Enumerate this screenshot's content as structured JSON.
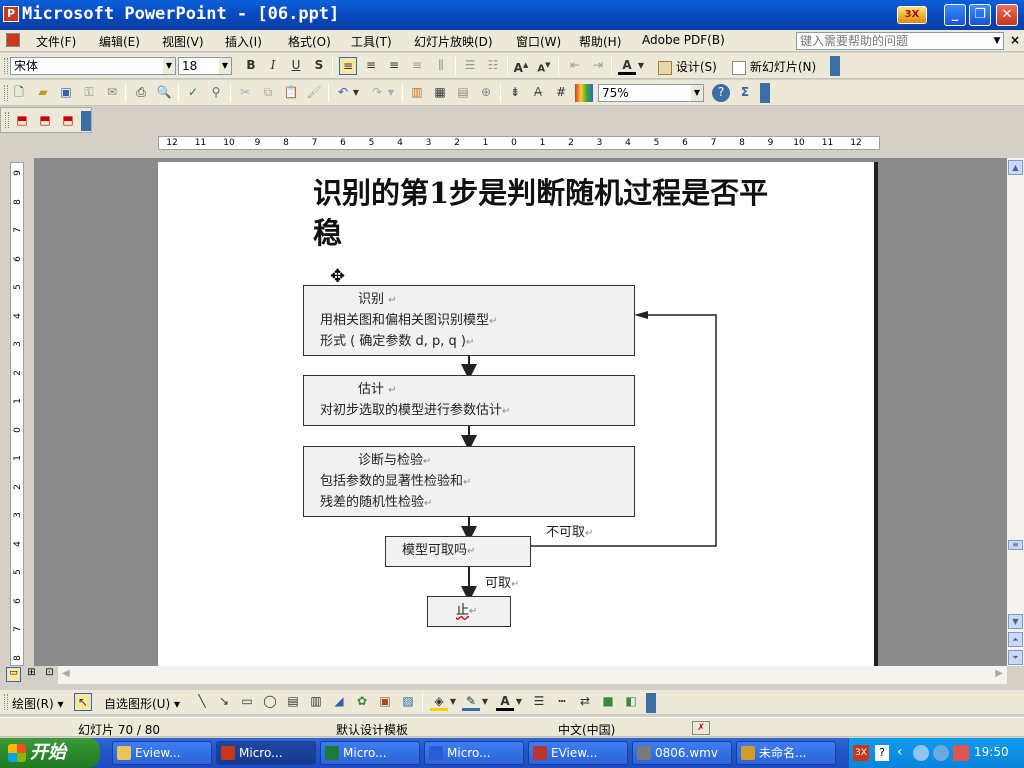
{
  "window": {
    "title": "Microsoft PowerPoint - [06.ppt]",
    "badge": "3X"
  },
  "menu": [
    "文件(F)",
    "编辑(E)",
    "视图(V)",
    "插入(I)",
    "格式(O)",
    "工具(T)",
    "幻灯片放映(D)",
    "窗口(W)",
    "帮助(H)",
    "Adobe PDF(B)"
  ],
  "help_box": {
    "placeholder": "键入需要帮助的问题"
  },
  "formatting": {
    "font": "宋体",
    "size": "18",
    "design_label": "设计(S)",
    "new_slide_label": "新幻灯片(N)"
  },
  "standard": {
    "zoom": "75%"
  },
  "ruler": {
    "top": [
      "12",
      "11",
      "10",
      "9",
      "8",
      "7",
      "6",
      "5",
      "4",
      "3",
      "2",
      "1",
      "0",
      "1",
      "2",
      "3",
      "4",
      "5",
      "6",
      "7",
      "8",
      "9",
      "10",
      "11",
      "12"
    ],
    "left": [
      "9",
      "8",
      "7",
      "6",
      "5",
      "4",
      "3",
      "2",
      "1",
      "0",
      "1",
      "2",
      "3",
      "4",
      "5",
      "6",
      "7",
      "8"
    ]
  },
  "slide": {
    "title": "识别的第1步是判断随机过程是否平稳",
    "boxes": [
      {
        "heading": "识别",
        "lines": [
          "用相关图和偏相关图识别模型",
          "形式 ( 确定参数 d, p, q )"
        ]
      },
      {
        "heading": "估计",
        "lines": [
          "对初步选取的模型进行参数估计"
        ]
      },
      {
        "heading": "诊断与检验",
        "lines": [
          "包括参数的显著性检验和",
          "残差的随机性检验"
        ]
      }
    ],
    "decision": "模型可取吗",
    "reject_label": "不可取",
    "accept_label": "可取",
    "end": "止",
    "return_mark": "↵"
  },
  "drawbar": {
    "draw_label": "绘图(R)",
    "autoshape_label": "自选图形(U)"
  },
  "status": {
    "slide": "幻灯片 70 / 80",
    "template": "默认设计模板",
    "language": "中文(中国)"
  },
  "taskbar": {
    "start": "开始",
    "tasks": [
      {
        "label": "Eview...",
        "color": "#e8c45a"
      },
      {
        "label": "Micro...",
        "color": "#c8391c"
      },
      {
        "label": "Micro...",
        "color": "#1d7a3a"
      },
      {
        "label": "Micro...",
        "color": "#2a5bd7"
      },
      {
        "label": "EView...",
        "color": "#b33"
      },
      {
        "label": "0806.wmv",
        "color": "#7a7a7a"
      },
      {
        "label": "未命名...",
        "color": "#d49a2a"
      }
    ],
    "clock": "19:50"
  }
}
